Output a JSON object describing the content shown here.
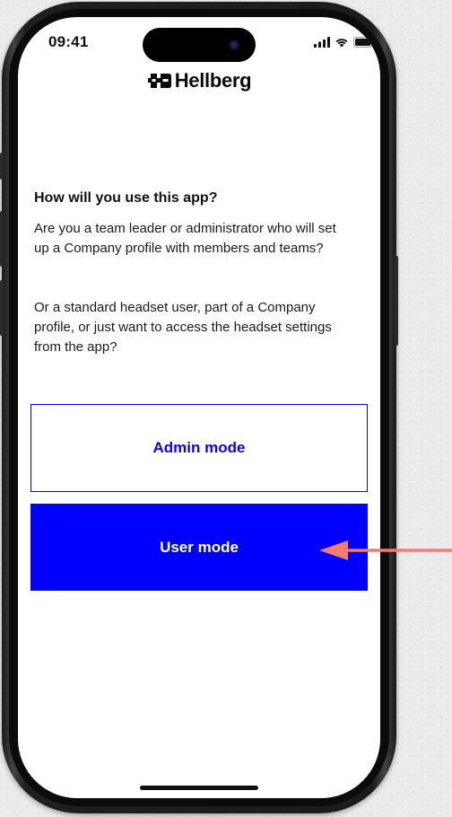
{
  "status_bar": {
    "time": "09:41",
    "icons": [
      "cellular-signal-icon",
      "wifi-icon",
      "battery-icon"
    ]
  },
  "brand": {
    "logo_icon": "hellberg-logo-icon",
    "name": "Hellberg"
  },
  "onboarding": {
    "heading": "How will you use this app?",
    "paragraph_1": "Are you a team leader or administrator who will set up a Company profile with members and teams?",
    "paragraph_2": "Or a standard headset user, part of a Company profile, or just want to access the headset settings from the app?"
  },
  "buttons": {
    "admin_label": "Admin mode",
    "user_label": "User mode"
  },
  "colors": {
    "accent": "#0000FF",
    "annotation_arrow": "#F47C6E"
  }
}
